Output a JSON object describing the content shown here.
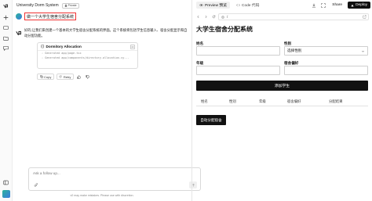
{
  "chat": {
    "title": "University Dorm System",
    "privacy_label": "Private",
    "user_message": "做一个大学生宿舍分配系统",
    "bot_message": "好的,让我们来创建一个基本的大学生宿舍分配系统的界面。这个系统将包括学生信息输入、宿舍分配显示和自动分配功能。",
    "artifact": {
      "title": "Dormitory Allocation",
      "lines": [
        "Generated app/page.tsx",
        "Generated app/components/directory-allocation-sy..."
      ]
    },
    "actions": {
      "copy": "Copy",
      "retry": "Retry"
    },
    "followup_placeholder": "Ask a follow up...",
    "disclaimer": "v0 may make mistakes. Please use with discretion."
  },
  "preview": {
    "tabs": [
      {
        "label": "Preview 预览",
        "active": true
      },
      {
        "label": "Code 代码",
        "active": false
      }
    ],
    "share_label": "Share",
    "deploy_label": "Deploy",
    "url": "/",
    "app": {
      "title": "大学生宿舍分配系统",
      "fields": {
        "name_label": "姓名",
        "gender_label": "性别",
        "gender_value": "选择性别",
        "grade_label": "年级",
        "preference_label": "宿舍偏好"
      },
      "add_button": "添加学生",
      "table_headers": [
        "姓名",
        "性别",
        "年级",
        "宿舍偏好",
        "分配结果"
      ],
      "auto_button": "自动分配宿舍"
    }
  },
  "colors": {
    "primary_button": "#111111",
    "highlight_border": "#e33333",
    "accent_avatar": "#2bb39a"
  },
  "icons": {
    "rail": [
      "v0-logo-icon",
      "plus-icon",
      "chat-history-icon",
      "projects-icon",
      "feedback-icon",
      "sidebar-toggle-icon"
    ],
    "toolbar": [
      "back-icon",
      "forward-icon",
      "refresh-icon",
      "globe-icon",
      "external-link-icon",
      "download-icon",
      "fullscreen-icon"
    ]
  }
}
